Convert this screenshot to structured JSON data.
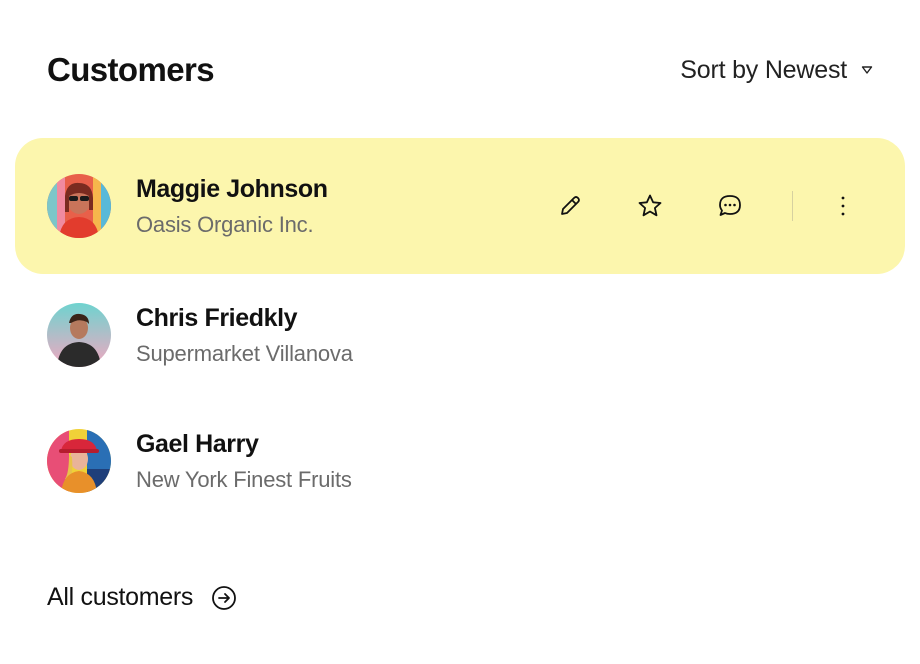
{
  "header": {
    "title": "Customers",
    "sort_label": "Sort by Newest",
    "sort_icon": "caret-down-icon"
  },
  "customers": [
    {
      "name": "Maggie Johnson",
      "company": "Oasis Organic Inc.",
      "selected": true
    },
    {
      "name": "Chris Friedkly",
      "company": "Supermarket Villanova",
      "selected": false
    },
    {
      "name": "Gael Harry",
      "company": "New York Finest Fruits",
      "selected": false
    }
  ],
  "row_actions": [
    "edit-icon",
    "star-icon",
    "message-icon",
    "more-vertical-icon"
  ],
  "footer": {
    "label": "All customers",
    "icon": "arrow-right-circle-icon"
  },
  "colors": {
    "highlight": "#fcf6ad",
    "text_primary": "#111111",
    "text_secondary": "#6b6b6b"
  }
}
